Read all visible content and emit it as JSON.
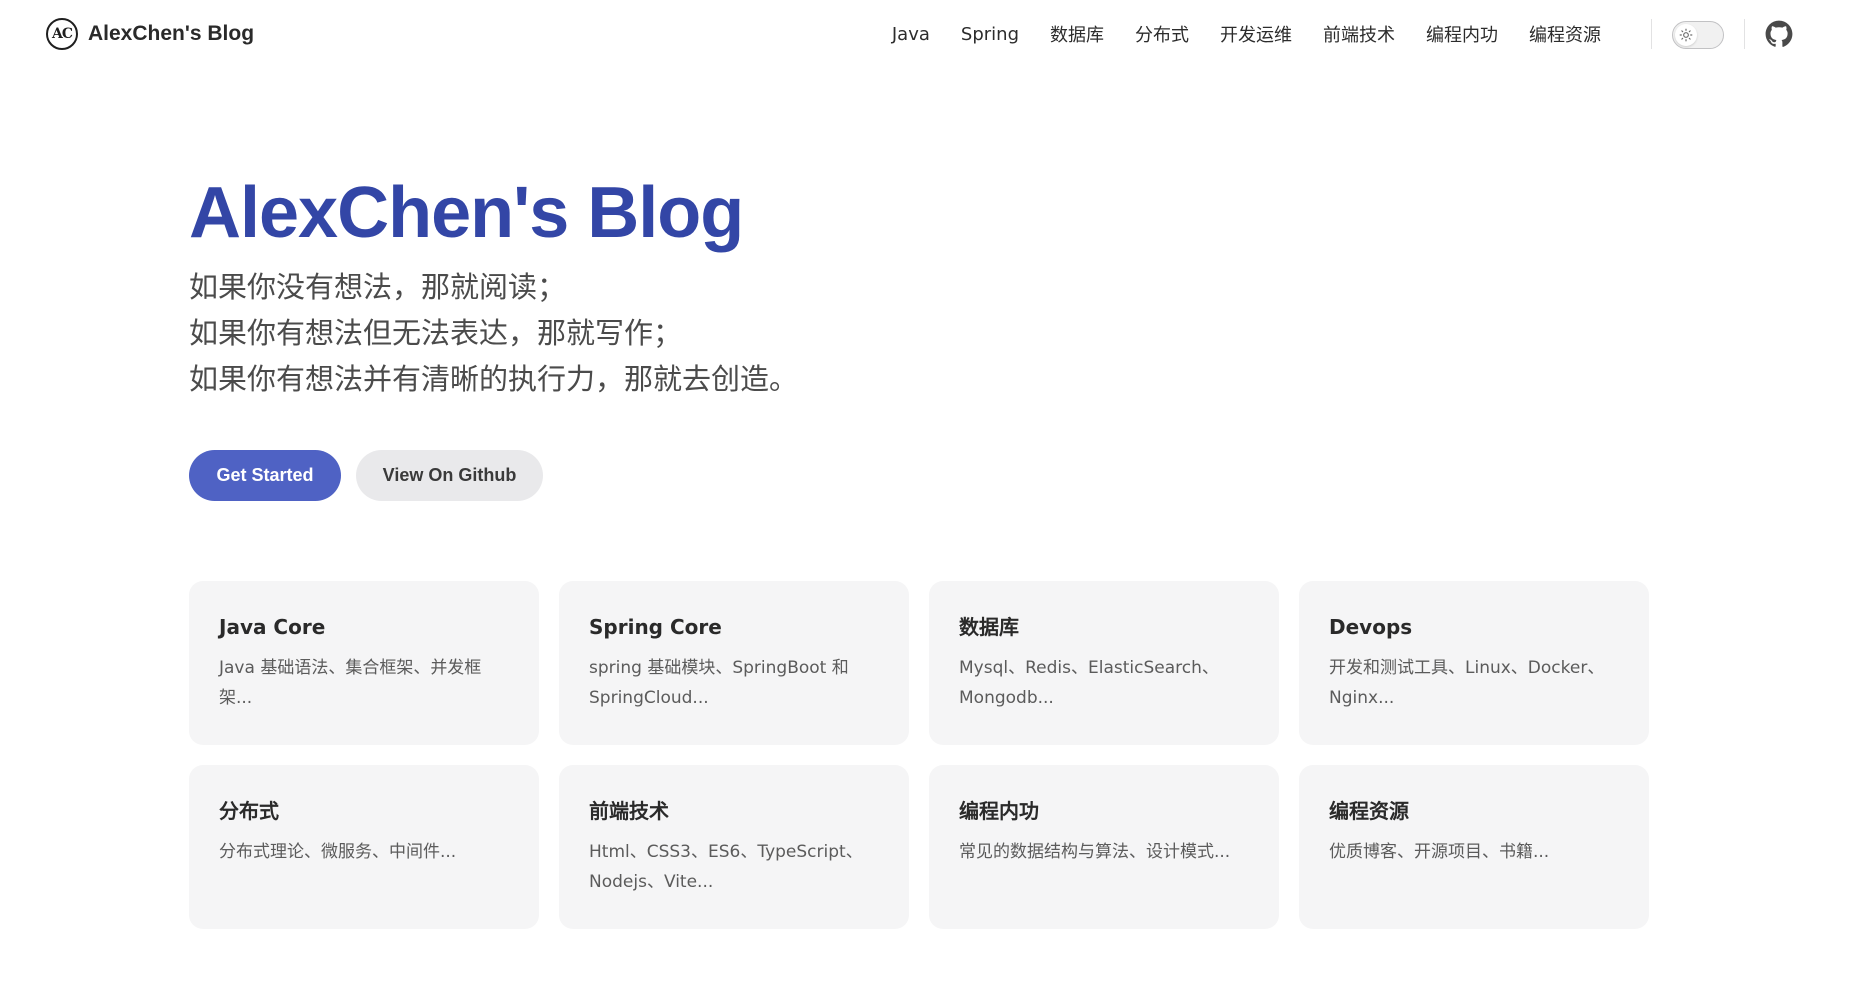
{
  "nav": {
    "logo_text": "AC",
    "brand": "AlexChen's Blog",
    "items": [
      {
        "label": "Java"
      },
      {
        "label": "Spring"
      },
      {
        "label": "数据库"
      },
      {
        "label": "分布式"
      },
      {
        "label": "开发运维"
      },
      {
        "label": "前端技术"
      },
      {
        "label": "编程内功"
      },
      {
        "label": "编程资源"
      }
    ],
    "theme_icon": "sun-icon",
    "github_icon": "github-icon"
  },
  "hero": {
    "title": "AlexChen's Blog",
    "tagline": [
      "如果你没有想法，那就阅读；",
      "如果你有想法但无法表达，那就写作；",
      "如果你有想法并有清晰的执行力，那就去创造。"
    ],
    "primary_action": "Get Started",
    "secondary_action": "View On Github"
  },
  "features": [
    {
      "title": "Java Core",
      "desc": "Java 基础语法、集合框架、并发框架..."
    },
    {
      "title": "Spring Core",
      "desc": "spring 基础模块、SpringBoot 和 SpringCloud..."
    },
    {
      "title": "数据库",
      "desc": "Mysql、Redis、ElasticSearch、Mongodb..."
    },
    {
      "title": "Devops",
      "desc": "开发和测试工具、Linux、Docker、Nginx..."
    },
    {
      "title": "分布式",
      "desc": "分布式理论、微服务、中间件..."
    },
    {
      "title": "前端技术",
      "desc": "Html、CSS3、ES6、TypeScript、Nodejs、Vite..."
    },
    {
      "title": "编程内功",
      "desc": "常见的数据结构与算法、设计模式..."
    },
    {
      "title": "编程资源",
      "desc": "优质博客、开源项目、书籍..."
    }
  ],
  "colors": {
    "brand": "#3346a6",
    "primary_button": "#4f62c4",
    "card_bg": "#f5f5f6"
  }
}
